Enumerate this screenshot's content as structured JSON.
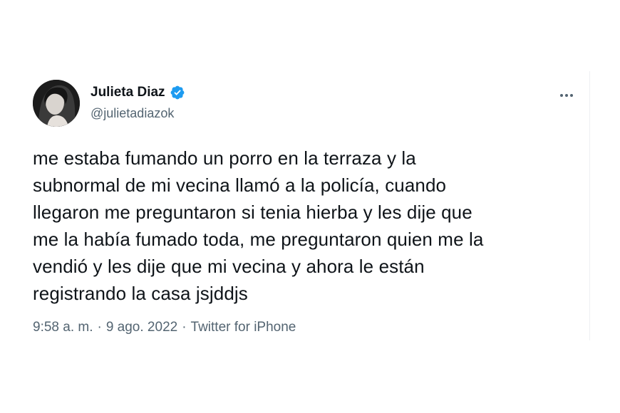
{
  "tweet": {
    "author": {
      "display_name": "Julieta Diaz",
      "handle": "@julietadiazok",
      "verified": true,
      "avatar_icon": "profile-photo"
    },
    "more_icon": "ellipsis-icon",
    "text": "me estaba fumando un porro en la terraza y la\nsubnormal de mi vecina llamó a la policía, cuando\nllegaron me preguntaron si tenia hierba y les dije que\nme la había fumado toda, me preguntaron quien me la\nvendió y les dije que mi vecina y ahora le están\nregistrando la casa jsjddjs",
    "time": "9:58 a. m.",
    "separator_1": "·",
    "date": "9 ago. 2022",
    "separator_2": "·",
    "source": "Twitter for iPhone"
  },
  "colors": {
    "primary_text": "#0f1419",
    "secondary_text": "#536471",
    "verified_blue": "#1d9bf0"
  }
}
